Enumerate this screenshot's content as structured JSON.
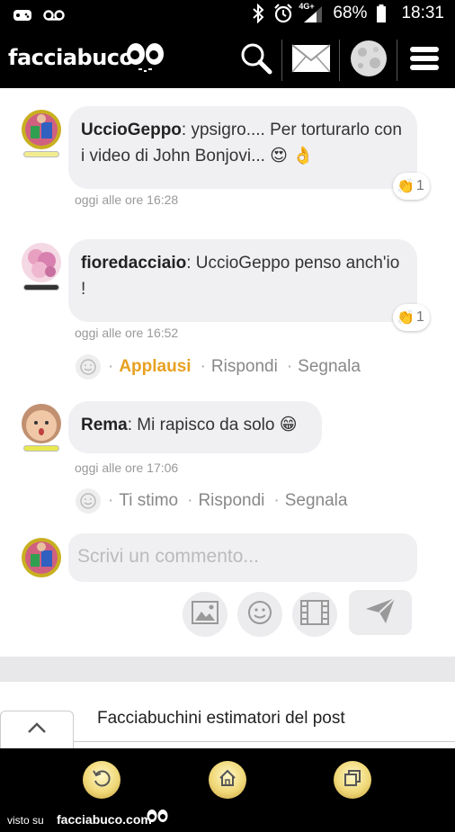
{
  "status_bar": {
    "network": "4G+",
    "battery": "68%",
    "time": "18:31"
  },
  "header": {
    "logo": "facciabuco"
  },
  "comments": [
    {
      "author": "UccioGeppo",
      "text": ": ypsigro.... Per torturarlo con i video di John Bonjovi... 😍 👌",
      "time": "oggi alle ore 16:28",
      "reaction_count": "1"
    },
    {
      "author": "fioredacciaio",
      "text": ": UccioGeppo penso anch'io !",
      "time": "oggi alle ore 16:52",
      "reaction_count": "1",
      "actions": {
        "clap": "Applausi",
        "reply": "Rispondi",
        "report": "Segnala"
      }
    },
    {
      "author": "Rema",
      "text": ": Mi rapisco da solo 😁",
      "time": "oggi alle ore 17:06",
      "actions": {
        "clap": "Ti stimo",
        "reply": "Rispondi",
        "report": "Segnala"
      }
    }
  ],
  "comment_input": {
    "placeholder": "Scrivi un commento..."
  },
  "estimators": {
    "label": "Facciabuchini estimatori del post"
  },
  "watermark": {
    "prefix": "visto su",
    "site": "facciabuco.com"
  },
  "colors": {
    "accent": "#e8a020",
    "bubble": "#f0f0f3"
  }
}
